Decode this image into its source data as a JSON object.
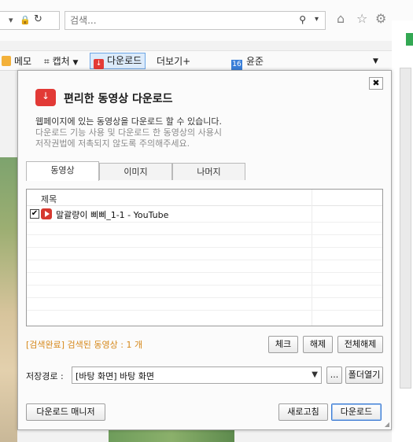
{
  "browser": {
    "search_placeholder": "검색...",
    "toolbar": {
      "memo_label": "메모",
      "capture_label": "캡처",
      "download_label": "다운로드",
      "more_label": "더보기+",
      "weather_badge": "16",
      "weather_label": "윤준"
    }
  },
  "dialog": {
    "title": "편리한 동영상 다운로드",
    "description": [
      "웹페이지에 있는 동영상을 다운로드 할 수 있습니다.",
      "다운로드 기능 사용 및 다운로드 한 동영상의 사용시",
      "저작권법에 저촉되지 않도록 주의해주세요."
    ],
    "tabs": [
      "동영상",
      "이미지",
      "나머지"
    ],
    "active_tab": 0,
    "list": {
      "column_header": "제목",
      "items": [
        {
          "checked": true,
          "title": "말괄량이 삐삐_1-1 - YouTube"
        }
      ]
    },
    "status_text": "[검색완료] 검색된 동영상 : 1 개",
    "buttons": {
      "check": "체크",
      "uncheck": "해제",
      "uncheck_all": "전체해제",
      "browse": "...",
      "open_folder": "폴더열기",
      "download_manager": "다운로드 매니저",
      "refresh": "새로고침",
      "download": "다운로드"
    },
    "save_path_label": "저장경로 :",
    "save_path_value": "[바탕 화면] 바탕 화면"
  },
  "colors": {
    "accent_red": "#e23a36",
    "status_orange": "#d6881a",
    "focus_blue": "#3d7bd3"
  }
}
